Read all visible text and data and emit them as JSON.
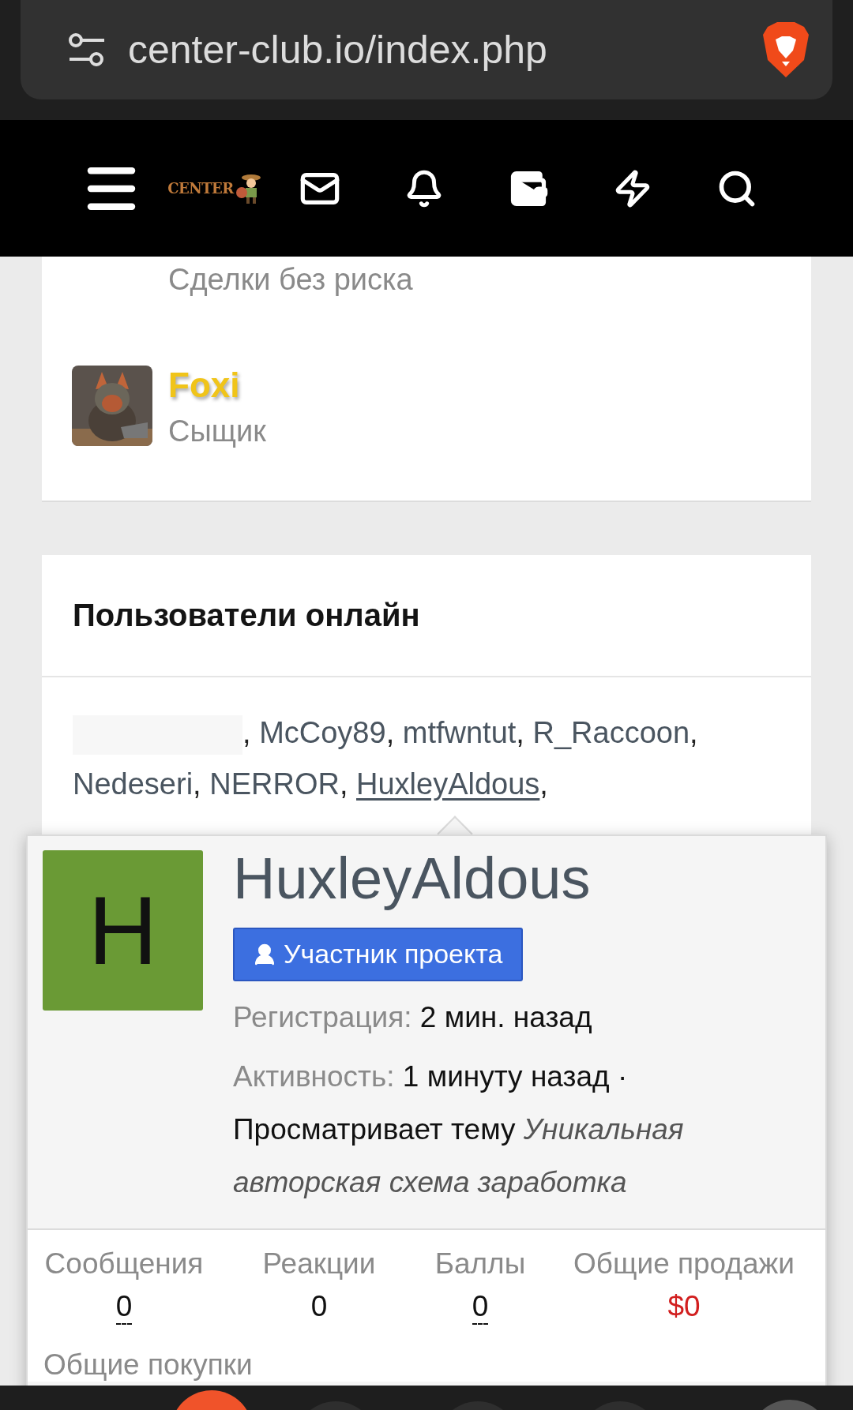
{
  "browser": {
    "url": "center-club.io/index.php"
  },
  "forum_nav": {
    "logo": "CENTER"
  },
  "staff_card": {
    "items": [
      {
        "title": "Сделки без риска",
        "kind": "cut"
      },
      {
        "name": "Foxi",
        "title": "Сыщик",
        "kind": "member"
      }
    ]
  },
  "online_users": {
    "title": "Пользователи онлайн",
    "separator": ",",
    "users": [
      {
        "kind": "redacted"
      },
      {
        "name": "McCoy89",
        "hovered": false
      },
      {
        "name": "mtfwntut",
        "hovered": false
      },
      {
        "name": "R_Raccoon",
        "hovered": false
      },
      {
        "name": "Nedeseri",
        "hovered": false
      },
      {
        "name": "NERROR",
        "hovered": false
      },
      {
        "name": "HuxleyAldous",
        "hovered": true
      }
    ]
  },
  "member_popup": {
    "avatar_letter": "H",
    "name": "HuxleyAldous",
    "badge": "Участник проекта",
    "registered_label": "Регистрация:",
    "registered": "2 мин. назад",
    "activity_label": "Активность:",
    "activity": "1 минуту назад ·",
    "viewing": "Просматривает тему *Уникальная авторская схема заработка*",
    "stats": [
      {
        "label": "Сообщения",
        "value": "0",
        "kind": "count",
        "underlined": true
      },
      {
        "label": "Реакции",
        "value": "0",
        "kind": "count",
        "underlined": false
      },
      {
        "label": "Баллы",
        "value": "0",
        "kind": "count",
        "underlined": true
      },
      {
        "label": "Общие продажи",
        "value": "$0",
        "kind": "money",
        "underlined": false
      }
    ],
    "more_label": "Общие покупки"
  }
}
